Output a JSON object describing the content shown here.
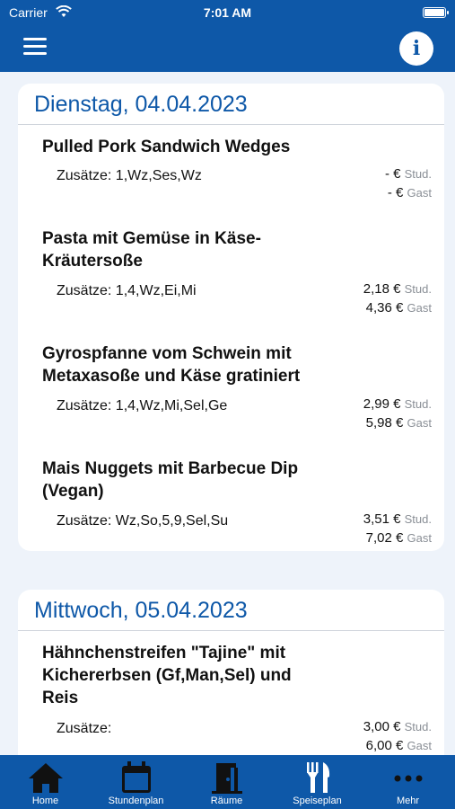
{
  "status_bar": {
    "carrier": "Carrier",
    "time": "7:01 AM"
  },
  "nav": {
    "info_label": "i"
  },
  "days": [
    {
      "date": "Dienstag, 04.04.2023",
      "meals": [
        {
          "name": "Pulled Pork Sandwich Wedges",
          "additives": "Zusätze: 1,Wz,Ses,Wz",
          "price_stud": "- €",
          "price_gast": "- €"
        },
        {
          "name": "Pasta mit Gemüse in Käse-Kräutersoße",
          "additives": "Zusätze: 1,4,Wz,Ei,Mi",
          "price_stud": "2,18 €",
          "price_gast": "4,36 €"
        },
        {
          "name": "Gyrospfanne vom Schwein mit Metaxasoße und Käse gratiniert",
          "additives": "Zusätze: 1,4,Wz,Mi,Sel,Ge",
          "price_stud": "2,99 €",
          "price_gast": "5,98 €"
        },
        {
          "name": "Mais Nuggets mit Barbecue Dip (Vegan)",
          "additives": "Zusätze: Wz,So,5,9,Sel,Su",
          "price_stud": "3,51 €",
          "price_gast": "7,02 €"
        }
      ]
    },
    {
      "date": "Mittwoch, 05.04.2023",
      "meals": [
        {
          "name": "Hähnchenstreifen \"Tajine\" mit Kichererbsen (Gf,Man,Sel) und Reis",
          "additives": "Zusätze:",
          "price_stud": "3,00 €",
          "price_gast": "6,00 €"
        }
      ]
    }
  ],
  "price_labels": {
    "stud": "Stud.",
    "gast": "Gast"
  },
  "tabs": [
    {
      "label": "Home",
      "icon": "home-icon"
    },
    {
      "label": "Stundenplan",
      "icon": "calendar-icon"
    },
    {
      "label": "Räume",
      "icon": "door-icon"
    },
    {
      "label": "Speiseplan",
      "icon": "fork-knife-icon"
    },
    {
      "label": "Mehr",
      "icon": "more-icon"
    }
  ],
  "active_tab": "Speiseplan",
  "colors": {
    "primary": "#0e58a8",
    "background": "#eef3fa",
    "muted": "#8a8f96"
  }
}
